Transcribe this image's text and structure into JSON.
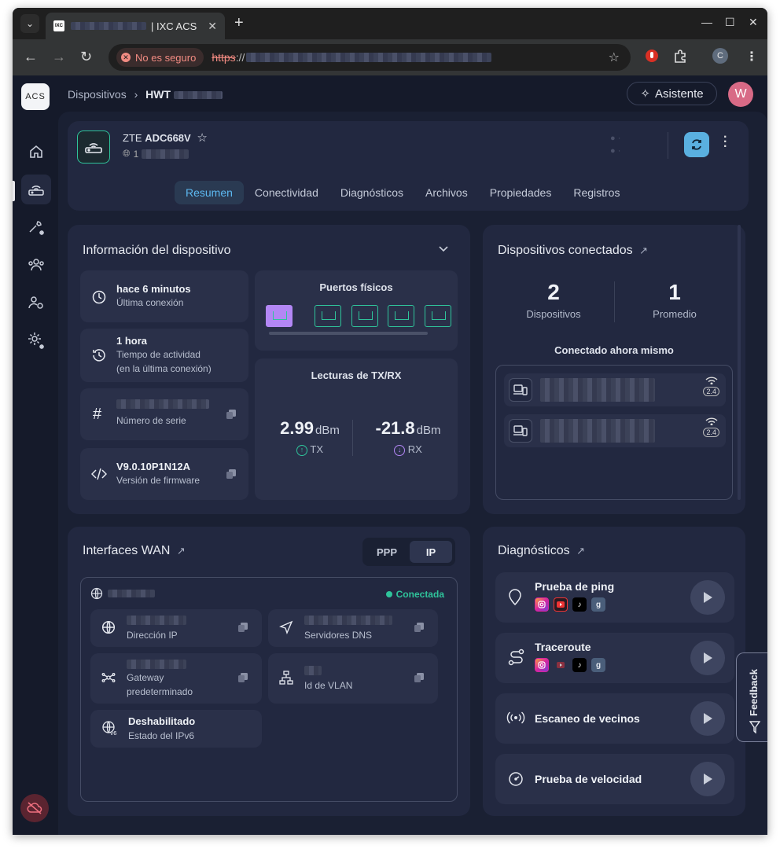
{
  "browser": {
    "tab_title": "| IXC ACS",
    "favicon_text": "IXC",
    "security_label": "No es seguro",
    "url_scheme": "https",
    "url_sep": "://"
  },
  "topbar": {
    "breadcrumb_root": "Dispositivos",
    "breadcrumb_sep": "›",
    "breadcrumb_device": "HWT",
    "assistant_label": "Asistente",
    "avatar_initial": "W",
    "logo_text": "ACS"
  },
  "device": {
    "brand": "ZTE",
    "model": "ADC668V",
    "ip_prefix": "1"
  },
  "tabs": [
    "Resumen",
    "Conectividad",
    "Diagnósticos",
    "Archivos",
    "Propiedades",
    "Registros"
  ],
  "info": {
    "title": "Información del dispositivo",
    "last_conn_value": "hace 6 minutos",
    "last_conn_label": "Última conexión",
    "uptime_value": "1 hora",
    "uptime_label_1": "Tiempo de actividad",
    "uptime_label_2": "(en la última conexión)",
    "serial_label": "Número de serie",
    "firmware_value": "V9.0.10P1N12A",
    "firmware_label": "Versión de firmware",
    "ports_title": "Puertos físicos",
    "txrx_title": "Lecturas de TX/RX",
    "tx_value": "2.99",
    "rx_value": "-21.8",
    "unit": "dBm",
    "tx_label": "TX",
    "rx_label": "RX"
  },
  "connected": {
    "title": "Dispositivos conectados",
    "devices_count": "2",
    "devices_label": "Dispositivos",
    "average_value": "1",
    "average_label": "Promedio",
    "now_label": "Conectado ahora mismo",
    "band": "2.4"
  },
  "wan": {
    "title": "Interfaces WAN",
    "seg_ppp": "PPP",
    "seg_ip": "IP",
    "status": "Conectada",
    "ip_label": "Dirección IP",
    "dns_label": "Servidores DNS",
    "gateway_label_1": "Gateway",
    "gateway_label_2": "predeterminado",
    "vlan_label": "Id de VLAN",
    "ipv6_value": "Deshabilitado",
    "ipv6_label": "Estado del IPv6"
  },
  "diagnostics": {
    "title": "Diagnósticos",
    "ping": "Prueba de ping",
    "traceroute": "Traceroute",
    "neighbors": "Escaneo de vecinos",
    "speed": "Prueba de velocidad",
    "g_letter": "g"
  },
  "feedback_label": "Feedback",
  "colors": {
    "accent": "#5cb8f0",
    "green": "#2fc49b",
    "purple": "#b387f5",
    "background": "#1a2033"
  }
}
